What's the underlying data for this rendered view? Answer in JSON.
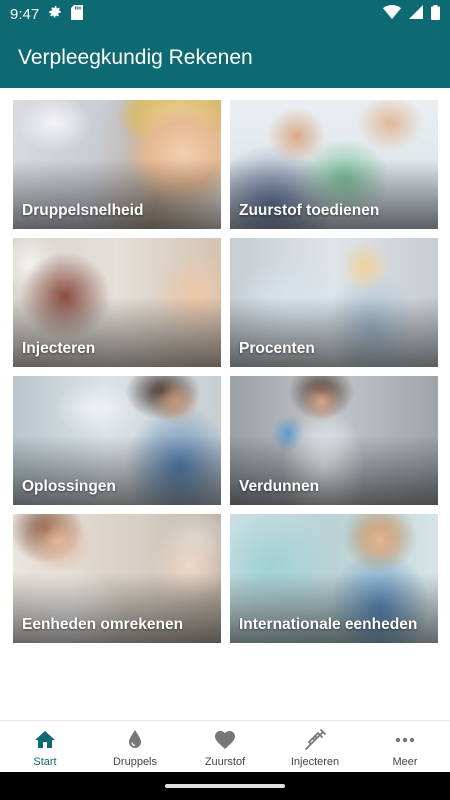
{
  "status_bar": {
    "time": "9:47"
  },
  "app_bar": {
    "title": "Verpleegkundig Rekenen"
  },
  "tiles": [
    {
      "label": "Druppelsnelheid"
    },
    {
      "label": "Zuurstof toedienen"
    },
    {
      "label": "Injecteren"
    },
    {
      "label": "Procenten"
    },
    {
      "label": "Oplossingen"
    },
    {
      "label": "Verdunnen"
    },
    {
      "label": "Eenheden omrekenen"
    },
    {
      "label": "Internationale eenheden"
    }
  ],
  "bottom_nav": {
    "items": [
      {
        "label": "Start",
        "icon": "home-icon",
        "active": true
      },
      {
        "label": "Druppels",
        "icon": "drop-icon",
        "active": false
      },
      {
        "label": "Zuurstof",
        "icon": "heart-icon",
        "active": false
      },
      {
        "label": "Injecteren",
        "icon": "syringe-icon",
        "active": false
      },
      {
        "label": "Meer",
        "icon": "more-icon",
        "active": false
      }
    ]
  },
  "colors": {
    "primary": "#0d6a72",
    "nav_inactive": "#777777"
  }
}
